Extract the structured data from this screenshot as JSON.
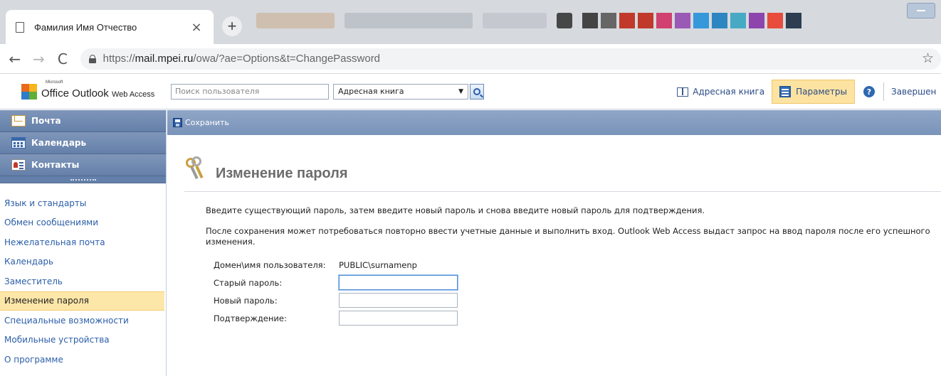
{
  "browser": {
    "tab_title": "Фамилия Имя Отчество",
    "tab_close": "×",
    "new_tab": "+",
    "url_scheme": "https://",
    "url_host": "mail.mpei.ru",
    "url_path": "/owa/?ae=Options&t=ChangePassword",
    "back": "←",
    "forward": "→",
    "reload": "C",
    "bookmark": "☆"
  },
  "owa_header": {
    "logo_small": "Microsoft",
    "logo_main": "Office Outlook",
    "logo_suffix": "Web Access",
    "search_placeholder": "Поиск пользователя",
    "address_book_select": "Адресная книга",
    "address_book_link": "Адресная книга",
    "options_link": "Параметры",
    "help": "?",
    "logout": "Завершен"
  },
  "nav": {
    "sections": [
      {
        "label": "Почта"
      },
      {
        "label": "Календарь"
      },
      {
        "label": "Контакты"
      }
    ],
    "options": [
      {
        "label": "Язык и стандарты"
      },
      {
        "label": "Обмен сообщениями"
      },
      {
        "label": "Нежелательная почта"
      },
      {
        "label": "Календарь"
      },
      {
        "label": "Заместитель"
      },
      {
        "label": "Изменение пароля"
      },
      {
        "label": "Специальные возможности"
      },
      {
        "label": "Мобильные устройства"
      },
      {
        "label": "О программе"
      }
    ]
  },
  "main": {
    "save_label": "Сохранить",
    "title": "Изменение пароля",
    "para1": "Введите существующий пароль, затем введите новый пароль и снова введите новый пароль для подтверждения.",
    "para2": "После сохранения может потребоваться повторно ввести учетные данные и выполнить вход. Outlook Web Access выдаст запрос на ввод пароля после его успешного изменения.",
    "form": {
      "domain_label": "Домен\\имя пользователя:",
      "domain_value": "PUBLIC\\surnamenp",
      "old_label": "Старый пароль:",
      "old_value": "",
      "new_label": "Новый пароль:",
      "new_value": "",
      "confirm_label": "Подтверждение:",
      "confirm_value": ""
    }
  },
  "colors": {
    "nav_header": "#6480aa",
    "selected_bg": "#fde7a8",
    "link": "#2b5ea8"
  }
}
